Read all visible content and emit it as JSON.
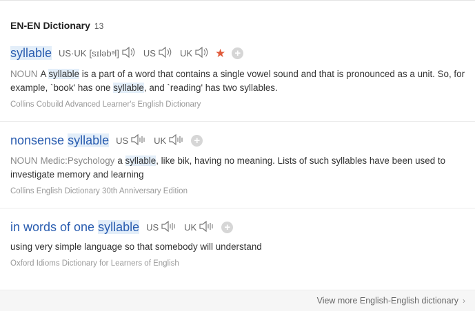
{
  "header": {
    "title": "EN-EN Dictionary",
    "count": "13"
  },
  "entries": [
    {
      "word_before": "",
      "word_hl": "syllable",
      "word_after": "",
      "pron_combined_label": "US·UK",
      "ipa": "[sɪləbᵊl]",
      "us_label": "US",
      "uk_label": "UK",
      "pos": "NOUN",
      "domain": "",
      "def_parts": [
        "A ",
        "syllable",
        " is a part of a word that contains a single vowel sound and that is pronounced as a unit. So, for example, `book' has one ",
        "syllable",
        ", and `reading' has two syllables."
      ],
      "source": "Collins Cobuild Advanced Learner's English Dictionary"
    },
    {
      "word_before": "nonsense ",
      "word_hl": "syllable",
      "word_after": "",
      "us_label": "US",
      "uk_label": "UK",
      "pos": "NOUN",
      "domain": "Medic:Psychology",
      "def_parts": [
        "a ",
        "syllable",
        ", like bik, having no meaning. Lists of such syllables have been used to investigate memory and learning"
      ],
      "source": "Collins English Dictionary 30th Anniversary Edition"
    },
    {
      "word_before": "in words of one ",
      "word_hl": "syllable",
      "word_after": "",
      "us_label": "US",
      "uk_label": "UK",
      "def": "using very simple language so that somebody will understand",
      "source": "Oxford Idioms Dictionary for Learners of English"
    }
  ],
  "footer": {
    "more_label": "View more English-English dictionary"
  },
  "colors": {
    "word": "#2a5db0",
    "highlight": "#e3eef9",
    "star": "#e05a3a"
  },
  "icons": {
    "speaker": "speaker-icon",
    "star": "star-icon",
    "add": "plus-circle-icon",
    "chevron": "chevron-right-icon"
  }
}
